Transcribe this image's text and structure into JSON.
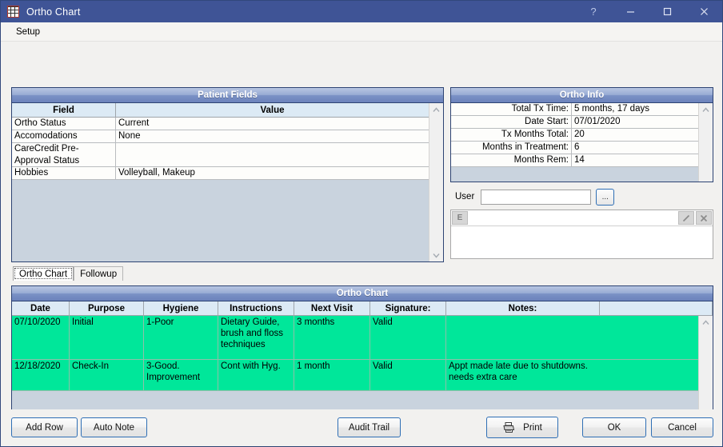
{
  "window": {
    "title": "Ortho Chart",
    "icon": "grid-window-icon",
    "controls": {
      "help": "?",
      "minimize": "minimize-icon",
      "maximize": "maximize-icon",
      "close": "close-icon"
    }
  },
  "menubar": {
    "items": [
      {
        "label": "Setup"
      }
    ]
  },
  "patient_fields": {
    "title": "Patient Fields",
    "columns": [
      "Field",
      "Value"
    ],
    "rows": [
      {
        "field": "Ortho Status",
        "value": "Current"
      },
      {
        "field": "Accomodations",
        "value": "None"
      },
      {
        "field": "CareCredit Pre-Approval Status",
        "value": ""
      },
      {
        "field": "Hobbies",
        "value": "Volleyball, Makeup"
      }
    ],
    "scrollbar": {
      "up": "▲",
      "down": "▼"
    }
  },
  "ortho_info": {
    "title": "Ortho Info",
    "rows": [
      {
        "label": "Total Tx Time:",
        "value": "5 months, 17 days"
      },
      {
        "label": "Date Start:",
        "value": "07/01/2020"
      },
      {
        "label": "Tx Months Total:",
        "value": "20"
      },
      {
        "label": "Months in Treatment:",
        "value": "6"
      },
      {
        "label": "Months Rem:",
        "value": "14"
      }
    ],
    "scrollbar": {
      "up": "▲"
    }
  },
  "user_section": {
    "label": "User",
    "input_value": "",
    "input_placeholder": "",
    "pick_button": "...",
    "list_toolbar": {
      "left_button": "E",
      "edit_button": "edit-pencil-icon",
      "delete_button": "delete-x-icon"
    }
  },
  "tabs": [
    {
      "label": "Ortho Chart",
      "active": true
    },
    {
      "label": "Followup",
      "active": false
    }
  ],
  "ortho_chart": {
    "title": "Ortho Chart",
    "columns": [
      "Date",
      "Purpose",
      "Hygiene",
      "Instructions",
      "Next Visit",
      "Signature:",
      "Notes:"
    ],
    "rows": [
      {
        "date": "07/10/2020",
        "purpose": "Initial",
        "hygiene": "1-Poor",
        "instructions": "Dietary Guide,\nbrush and floss\ntechniques",
        "next_visit": "3 months",
        "signature": "Valid",
        "notes": ""
      },
      {
        "date": "12/18/2020",
        "purpose": "Check-In",
        "hygiene": "3-Good.\nImprovement",
        "instructions": "Cont with Hyg.",
        "next_visit": "1 month",
        "signature": "Valid",
        "notes": "Appt made late due to shutdowns.\nneeds extra care"
      }
    ],
    "row_highlight_color": "#00e79a",
    "scrollbar": {
      "up": "▲",
      "down": "▼",
      "left": "◀",
      "right": "▶"
    }
  },
  "footer": {
    "add_row": "Add Row",
    "auto_note": "Auto Note",
    "audit_trail": "Audit Trail",
    "print": "Print",
    "ok": "OK",
    "cancel": "Cancel"
  },
  "colors": {
    "titlebar": "#3f5496",
    "panel_border": "#2d4373",
    "panel_header_blue": "#7b92c6",
    "grid_header": "#dceaf5",
    "selected_row": "#00e79a",
    "window_bg": "#f2f1ef"
  }
}
